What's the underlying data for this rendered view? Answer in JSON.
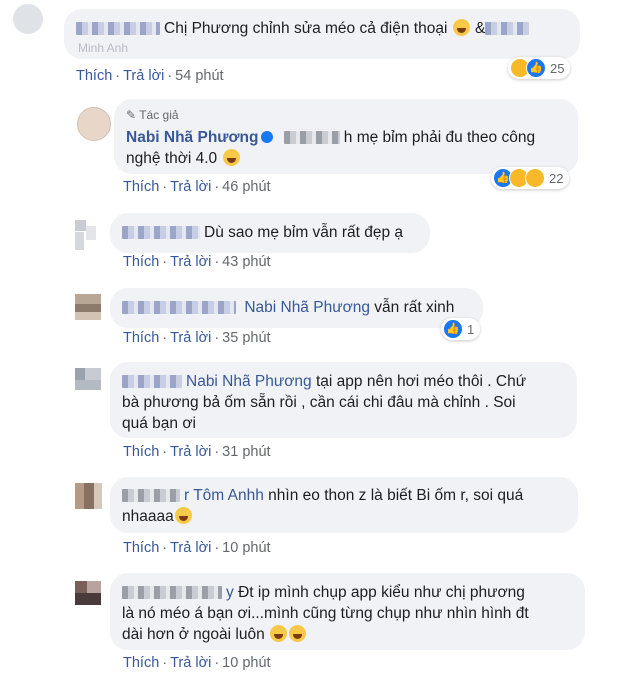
{
  "comments": [
    {
      "id": "c1",
      "text": "Chị Phương chỉnh sửa méo cả điện thoại",
      "suffix": "&",
      "tail": "Minh Anh",
      "actions": {
        "like": "Thích",
        "reply": "Trả lời",
        "time": "54 phút"
      },
      "reactions": {
        "count": "25",
        "types": [
          "haha-icon",
          "like-icon"
        ]
      }
    },
    {
      "id": "c2",
      "author_label": "Tác giả",
      "author": "Nabi Nhã Phương",
      "text_line1": "h mẹ bỉm phải đu theo công",
      "text_line2": "nghệ thời 4.0",
      "actions": {
        "like": "Thích",
        "reply": "Trả lời",
        "time": "46 phút"
      },
      "reactions": {
        "count": "22",
        "types": [
          "like-icon",
          "haha-icon",
          "wow-icon"
        ]
      }
    },
    {
      "id": "c3",
      "text": "Dù sao mẹ bỉm vẫn rất đẹp ạ",
      "actions": {
        "like": "Thích",
        "reply": "Trả lời",
        "time": "43 phút"
      }
    },
    {
      "id": "c4",
      "tag": "Nabi Nhã Phương",
      "text": "vẫn rất xinh",
      "actions": {
        "like": "Thích",
        "reply": "Trả lời",
        "time": "35 phút"
      },
      "reactions": {
        "count": "1",
        "types": [
          "like-icon"
        ]
      }
    },
    {
      "id": "c5",
      "tag": "Nabi Nhã Phương",
      "text_line1": "tại app nên hơi méo thôi . Chứ",
      "text_line2": "bà phương bả ốm sẵn rồi , cần cái chi đâu mà chỉnh . Soi",
      "text_line3": "quá bạn ơi",
      "actions": {
        "like": "Thích",
        "reply": "Trả lời",
        "time": "31 phút"
      }
    },
    {
      "id": "c6",
      "prefix": "r",
      "tag": "Tôm Anhh",
      "text_line1": "nhìn eo thon z là biết Bi ốm r, soi quá",
      "text_line2": "nhaaaa",
      "actions": {
        "like": "Thích",
        "reply": "Trả lời",
        "time": "10 phút"
      }
    },
    {
      "id": "c7",
      "prefix": "y",
      "text_line1": "Đt ip mình chụp app kiểu như chị phương",
      "text_line2": "là nó méo á bạn ơi...mình cũng từng chụp như nhìn hình đt",
      "text_line3": "dài hơn ở ngoài luôn",
      "actions": {
        "like": "Thích",
        "reply": "Trả lời",
        "time": "10 phút"
      }
    }
  ]
}
